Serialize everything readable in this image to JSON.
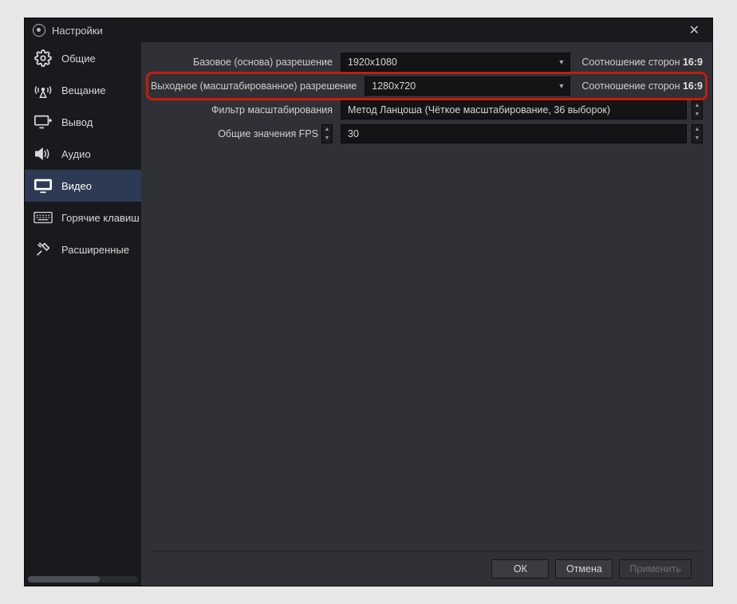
{
  "window": {
    "title": "Настройки"
  },
  "sidebar": {
    "items": [
      {
        "label": "Общие"
      },
      {
        "label": "Вещание"
      },
      {
        "label": "Вывод"
      },
      {
        "label": "Аудио"
      },
      {
        "label": "Видео"
      },
      {
        "label": "Горячие клавиш"
      },
      {
        "label": "Расширенные"
      }
    ],
    "active_index": 4
  },
  "video": {
    "base_label": "Базовое (основа) разрешение",
    "base_value": "1920x1080",
    "base_aspect_prefix": "Соотношение сторон ",
    "base_aspect_value": "16:9",
    "output_label": "Выходное (масштабированное) разрешение",
    "output_value": "1280x720",
    "output_aspect_prefix": "Соотношение сторон ",
    "output_aspect_value": "16:9",
    "filter_label": "Фильтр масштабирования",
    "filter_value": "Метод Ланцоша (Чёткое масштабирование, 36 выборок)",
    "fps_label": "Общие значения FPS",
    "fps_value": "30"
  },
  "footer": {
    "ok": "ОК",
    "cancel": "Отмена",
    "apply": "Применить"
  }
}
